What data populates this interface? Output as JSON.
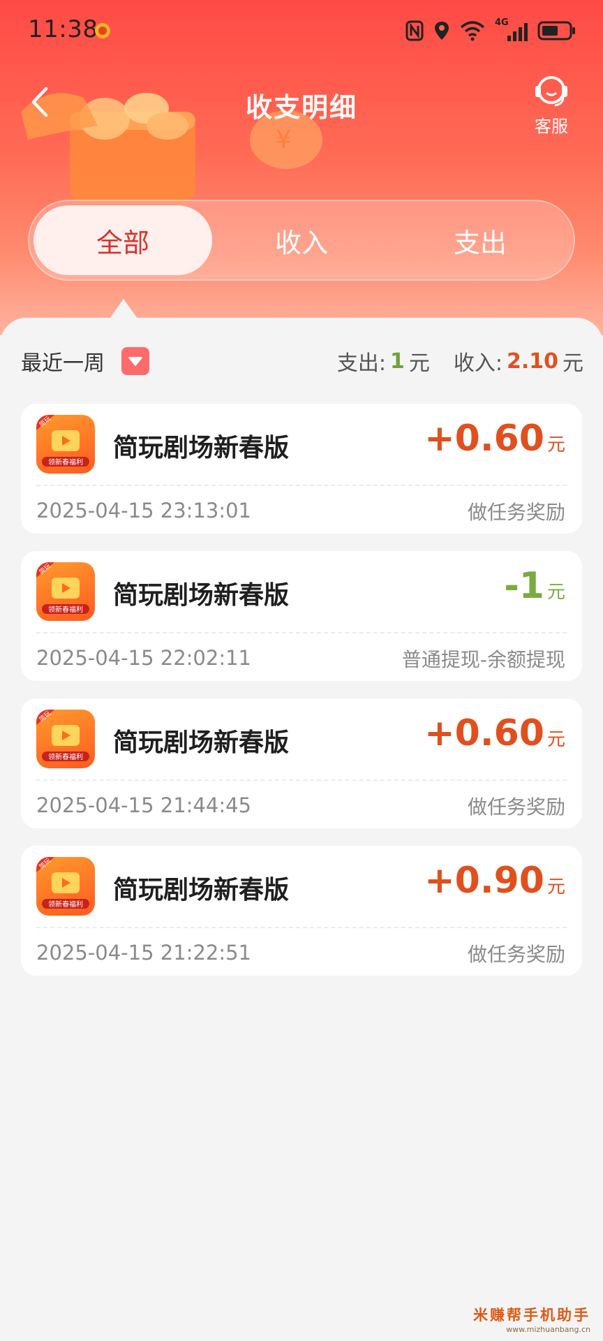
{
  "status_bar": {
    "time": "11:38",
    "network": "4G"
  },
  "header": {
    "title": "收支明细",
    "service_label": "客服"
  },
  "tabs": [
    {
      "label": "全部",
      "active": true
    },
    {
      "label": "收入",
      "active": false
    },
    {
      "label": "支出",
      "active": false
    }
  ],
  "filter": {
    "period": "最近一周",
    "expense_label": "支出:",
    "expense_value": "1",
    "income_label": "收入:",
    "income_value": "2.10",
    "unit": "元"
  },
  "icon_badge": "简玩",
  "icon_caption": "领新春福利",
  "transactions": [
    {
      "name": "简玩剧场新春版",
      "amount": "+0.60",
      "unit": "元",
      "type": "income",
      "datetime": "2025-04-15 23:13:01",
      "desc": "做任务奖励"
    },
    {
      "name": "简玩剧场新春版",
      "amount": "-1",
      "unit": "元",
      "type": "expense",
      "datetime": "2025-04-15 22:02:11",
      "desc": "普通提现-余额提现"
    },
    {
      "name": "简玩剧场新春版",
      "amount": "+0.60",
      "unit": "元",
      "type": "income",
      "datetime": "2025-04-15 21:44:45",
      "desc": "做任务奖励"
    },
    {
      "name": "简玩剧场新春版",
      "amount": "+0.90",
      "unit": "元",
      "type": "income",
      "datetime": "2025-04-15 21:22:51",
      "desc": "做任务奖励"
    }
  ],
  "colors": {
    "income": "#e0501f",
    "expense": "#7aab3f",
    "header": "#ff4a45",
    "tab_active_text": "#d8322c"
  },
  "watermark": {
    "line1": "米赚帮手机助手",
    "line2": "www.mizhuanbang.cn"
  }
}
